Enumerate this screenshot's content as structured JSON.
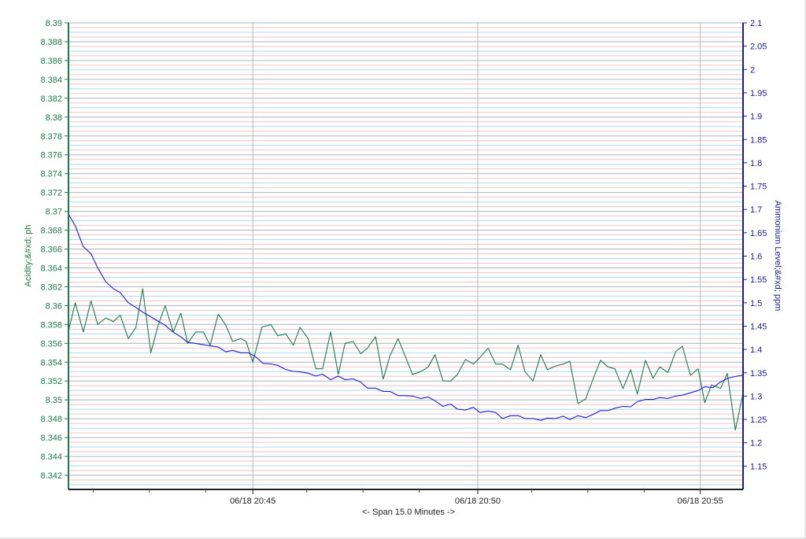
{
  "chart_data": {
    "type": "line",
    "xlabel": "<- Span 15.0 Minutes ->",
    "x_ticks": [
      {
        "t": 4.1,
        "label": "06/18 20:45"
      },
      {
        "t": 9.1,
        "label": "06/18 20:50"
      },
      {
        "t": 14.05,
        "label": "06/18 20:55"
      }
    ],
    "x_minor_ticks": [
      0.55,
      1.8,
      3.05,
      5.3,
      6.55,
      7.8,
      10.3,
      11.55,
      12.8
    ],
    "x_range": [
      0,
      15
    ],
    "left_axis": {
      "label": "Acidity;&#xd; ph",
      "ylim": [
        8.3405,
        8.39
      ],
      "ticks": [
        "8.342",
        "8.344",
        "8.346",
        "8.348",
        "8.35",
        "8.352",
        "8.354",
        "8.356",
        "8.358",
        "8.36",
        "8.362",
        "8.364",
        "8.366",
        "8.368",
        "8.37",
        "8.372",
        "8.374",
        "8.376",
        "8.378",
        "8.38",
        "8.382",
        "8.384",
        "8.386",
        "8.388",
        "8.39"
      ],
      "color": "#1e7a4a"
    },
    "right_axis": {
      "label": "Ammonium Level;&#xd; ppm",
      "ylim": [
        1.1,
        2.1
      ],
      "ticks": [
        "1.15",
        "1.2",
        "1.25",
        "1.3",
        "1.35",
        "1.4",
        "1.45",
        "1.5",
        "1.55",
        "1.6",
        "1.65",
        "1.7",
        "1.75",
        "1.8",
        "1.85",
        "1.9",
        "1.95",
        "2",
        "2.05",
        "2.1"
      ],
      "color": "#1b1b9a"
    },
    "grid": true,
    "series": [
      {
        "axis": "left",
        "color": "#1e7a4a",
        "points": [
          [
            0.0,
            8.3573
          ],
          [
            0.15,
            8.3603
          ],
          [
            0.33,
            8.3572
          ],
          [
            0.5,
            8.3605
          ],
          [
            0.65,
            8.358
          ],
          [
            0.83,
            8.3587
          ],
          [
            1.0,
            8.3583
          ],
          [
            1.15,
            8.359
          ],
          [
            1.33,
            8.3565
          ],
          [
            1.5,
            8.3577
          ],
          [
            1.65,
            8.3618
          ],
          [
            1.83,
            8.355
          ],
          [
            2.0,
            8.358
          ],
          [
            2.15,
            8.36
          ],
          [
            2.33,
            8.3572
          ],
          [
            2.5,
            8.3592
          ],
          [
            2.65,
            8.356
          ],
          [
            2.83,
            8.3572
          ],
          [
            3.0,
            8.3572
          ],
          [
            3.15,
            8.3558
          ],
          [
            3.33,
            8.3591
          ],
          [
            3.5,
            8.3579
          ],
          [
            3.65,
            8.3562
          ],
          [
            3.83,
            8.3565
          ],
          [
            3.95,
            8.3562
          ],
          [
            4.1,
            8.354
          ],
          [
            4.3,
            8.3577
          ],
          [
            4.5,
            8.358
          ],
          [
            4.65,
            8.3568
          ],
          [
            4.83,
            8.357
          ],
          [
            5.0,
            8.3558
          ],
          [
            5.15,
            8.3577
          ],
          [
            5.33,
            8.3565
          ],
          [
            5.5,
            8.3533
          ],
          [
            5.65,
            8.3533
          ],
          [
            5.83,
            8.3572
          ],
          [
            6.0,
            8.3527
          ],
          [
            6.15,
            8.356
          ],
          [
            6.33,
            8.3562
          ],
          [
            6.5,
            8.3549
          ],
          [
            6.65,
            8.3555
          ],
          [
            6.83,
            8.3567
          ],
          [
            7.0,
            8.3522
          ],
          [
            7.15,
            8.3547
          ],
          [
            7.33,
            8.3565
          ],
          [
            7.5,
            8.3545
          ],
          [
            7.65,
            8.3527
          ],
          [
            7.83,
            8.353
          ],
          [
            8.0,
            8.3535
          ],
          [
            8.15,
            8.3548
          ],
          [
            8.33,
            8.352
          ],
          [
            8.5,
            8.352
          ],
          [
            8.65,
            8.3527
          ],
          [
            8.83,
            8.3543
          ],
          [
            9.0,
            8.3538
          ],
          [
            9.15,
            8.3545
          ],
          [
            9.33,
            8.3555
          ],
          [
            9.5,
            8.3538
          ],
          [
            9.65,
            8.3538
          ],
          [
            9.83,
            8.3532
          ],
          [
            10.0,
            8.3558
          ],
          [
            10.15,
            8.353
          ],
          [
            10.33,
            8.352
          ],
          [
            10.5,
            8.3548
          ],
          [
            10.65,
            8.3532
          ],
          [
            10.83,
            8.3536
          ],
          [
            11.0,
            8.3538
          ],
          [
            11.15,
            8.3541
          ],
          [
            11.33,
            8.3496
          ],
          [
            11.5,
            8.3501
          ],
          [
            11.65,
            8.352
          ],
          [
            11.83,
            8.3542
          ],
          [
            12.0,
            8.3535
          ],
          [
            12.15,
            8.3533
          ],
          [
            12.33,
            8.3512
          ],
          [
            12.5,
            8.3532
          ],
          [
            12.65,
            8.3506
          ],
          [
            12.83,
            8.3542
          ],
          [
            13.0,
            8.3523
          ],
          [
            13.15,
            8.3535
          ],
          [
            13.33,
            8.3529
          ],
          [
            13.5,
            8.3551
          ],
          [
            13.65,
            8.3557
          ],
          [
            13.83,
            8.3526
          ],
          [
            14.0,
            8.3533
          ],
          [
            14.15,
            8.3497
          ],
          [
            14.3,
            8.3516
          ],
          [
            14.5,
            8.3512
          ],
          [
            14.65,
            8.3528
          ],
          [
            14.83,
            8.3468
          ],
          [
            15.0,
            8.3507
          ]
        ]
      },
      {
        "axis": "right",
        "color": "#1b1bd0",
        "points": [
          [
            0.0,
            1.69
          ],
          [
            0.15,
            1.665
          ],
          [
            0.33,
            1.62
          ],
          [
            0.5,
            1.605
          ],
          [
            0.65,
            1.575
          ],
          [
            0.83,
            1.545
          ],
          [
            1.0,
            1.53
          ],
          [
            1.15,
            1.522
          ],
          [
            1.33,
            1.5
          ],
          [
            1.5,
            1.49
          ],
          [
            1.65,
            1.48
          ],
          [
            1.83,
            1.47
          ],
          [
            2.0,
            1.46
          ],
          [
            2.15,
            1.452
          ],
          [
            2.33,
            1.437
          ],
          [
            2.5,
            1.427
          ],
          [
            2.65,
            1.415
          ],
          [
            2.83,
            1.413
          ],
          [
            3.0,
            1.41
          ],
          [
            3.15,
            1.408
          ],
          [
            3.33,
            1.405
          ],
          [
            3.5,
            1.395
          ],
          [
            3.65,
            1.398
          ],
          [
            3.83,
            1.393
          ],
          [
            4.0,
            1.393
          ],
          [
            4.15,
            1.385
          ],
          [
            4.33,
            1.37
          ],
          [
            4.5,
            1.369
          ],
          [
            4.65,
            1.366
          ],
          [
            4.83,
            1.357
          ],
          [
            5.0,
            1.353
          ],
          [
            5.15,
            1.352
          ],
          [
            5.33,
            1.349
          ],
          [
            5.5,
            1.343
          ],
          [
            5.65,
            1.347
          ],
          [
            5.83,
            1.335
          ],
          [
            6.0,
            1.343
          ],
          [
            6.15,
            1.335
          ],
          [
            6.33,
            1.337
          ],
          [
            6.5,
            1.33
          ],
          [
            6.65,
            1.317
          ],
          [
            6.83,
            1.317
          ],
          [
            7.0,
            1.31
          ],
          [
            7.15,
            1.31
          ],
          [
            7.33,
            1.301
          ],
          [
            7.5,
            1.301
          ],
          [
            7.65,
            1.3
          ],
          [
            7.83,
            1.295
          ],
          [
            8.0,
            1.298
          ],
          [
            8.15,
            1.29
          ],
          [
            8.33,
            1.278
          ],
          [
            8.5,
            1.283
          ],
          [
            8.65,
            1.272
          ],
          [
            8.83,
            1.27
          ],
          [
            9.0,
            1.276
          ],
          [
            9.15,
            1.265
          ],
          [
            9.33,
            1.268
          ],
          [
            9.5,
            1.265
          ],
          [
            9.65,
            1.252
          ],
          [
            9.83,
            1.258
          ],
          [
            10.0,
            1.258
          ],
          [
            10.15,
            1.252
          ],
          [
            10.33,
            1.252
          ],
          [
            10.5,
            1.248
          ],
          [
            10.65,
            1.253
          ],
          [
            10.83,
            1.252
          ],
          [
            11.0,
            1.257
          ],
          [
            11.15,
            1.25
          ],
          [
            11.33,
            1.258
          ],
          [
            11.5,
            1.254
          ],
          [
            11.65,
            1.26
          ],
          [
            11.83,
            1.269
          ],
          [
            12.0,
            1.269
          ],
          [
            12.15,
            1.274
          ],
          [
            12.33,
            1.278
          ],
          [
            12.5,
            1.277
          ],
          [
            12.65,
            1.288
          ],
          [
            12.83,
            1.293
          ],
          [
            13.0,
            1.293
          ],
          [
            13.15,
            1.297
          ],
          [
            13.33,
            1.295
          ],
          [
            13.5,
            1.3
          ],
          [
            13.65,
            1.302
          ],
          [
            13.83,
            1.307
          ],
          [
            14.0,
            1.312
          ],
          [
            14.15,
            1.32
          ],
          [
            14.33,
            1.318
          ],
          [
            14.5,
            1.33
          ],
          [
            14.65,
            1.338
          ],
          [
            14.83,
            1.342
          ],
          [
            15.0,
            1.345
          ]
        ]
      }
    ]
  }
}
